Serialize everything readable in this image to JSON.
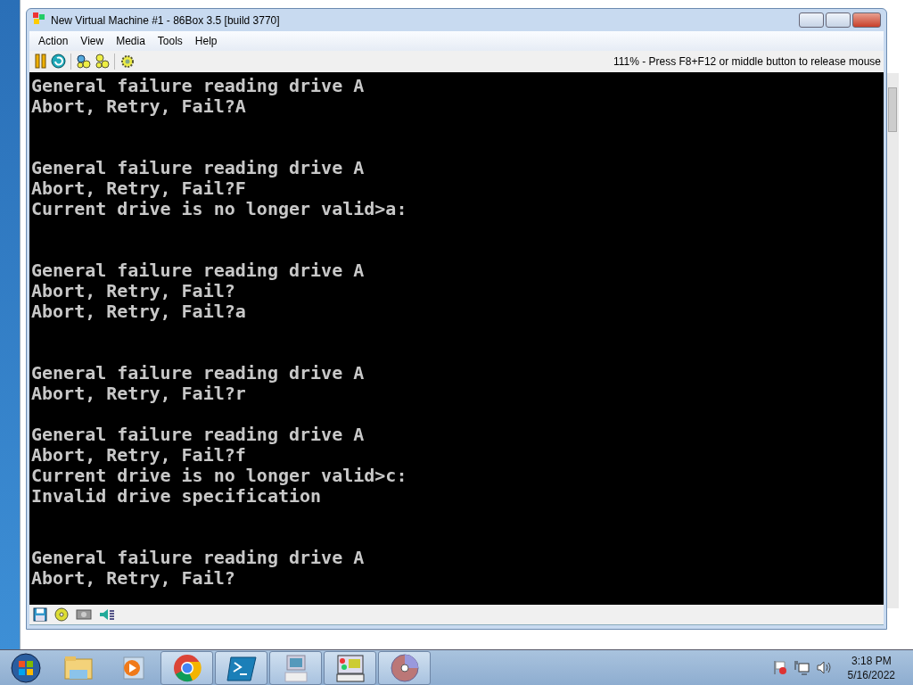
{
  "window": {
    "title": "New Virtual Machine #1 - 86Box 3.5 [build 3770]"
  },
  "menu": [
    "Action",
    "View",
    "Media",
    "Tools",
    "Help"
  ],
  "toolbar": {
    "status": "111% - Press F8+F12 or middle button to release mouse"
  },
  "screen": {
    "lines": [
      {
        "kind": "text",
        "text": "General failure reading drive A"
      },
      {
        "kind": "text",
        "text": "Abort, Retry, Fail?A"
      },
      {
        "kind": "blank"
      },
      {
        "kind": "blank"
      },
      {
        "kind": "text",
        "text": "General failure reading drive A"
      },
      {
        "kind": "text",
        "text": "Abort, Retry, Fail?F"
      },
      {
        "kind": "text",
        "text": "Current drive is no longer valid>a:"
      },
      {
        "kind": "blank"
      },
      {
        "kind": "blank"
      },
      {
        "kind": "text",
        "text": "General failure reading drive A"
      },
      {
        "kind": "text",
        "text": "Abort, Retry, Fail?"
      },
      {
        "kind": "text",
        "text": "Abort, Retry, Fail?a"
      },
      {
        "kind": "blank"
      },
      {
        "kind": "blank"
      },
      {
        "kind": "text",
        "text": "General failure reading drive A"
      },
      {
        "kind": "text",
        "text": "Abort, Retry, Fail?r"
      },
      {
        "kind": "blank"
      },
      {
        "kind": "text",
        "text": "General failure reading drive A"
      },
      {
        "kind": "text",
        "text": "Abort, Retry, Fail?f"
      },
      {
        "kind": "text",
        "text": "Current drive is no longer valid>c:"
      },
      {
        "kind": "text",
        "text": "Invalid drive specification"
      },
      {
        "kind": "blank"
      },
      {
        "kind": "blank"
      },
      {
        "kind": "text",
        "text": "General failure reading drive A"
      },
      {
        "kind": "text",
        "text": "Abort, Retry, Fail?"
      }
    ]
  },
  "taskbar": {
    "apps": [
      {
        "kind": "explorer",
        "running": false
      },
      {
        "kind": "media",
        "running": false
      },
      {
        "kind": "browser",
        "running": true
      },
      {
        "kind": "shell",
        "running": true
      },
      {
        "kind": "vm",
        "running": true
      },
      {
        "kind": "emulator",
        "running": true
      },
      {
        "kind": "disc",
        "running": true
      }
    ],
    "clock": {
      "time": "3:18 PM",
      "date": "5/16/2022"
    }
  }
}
